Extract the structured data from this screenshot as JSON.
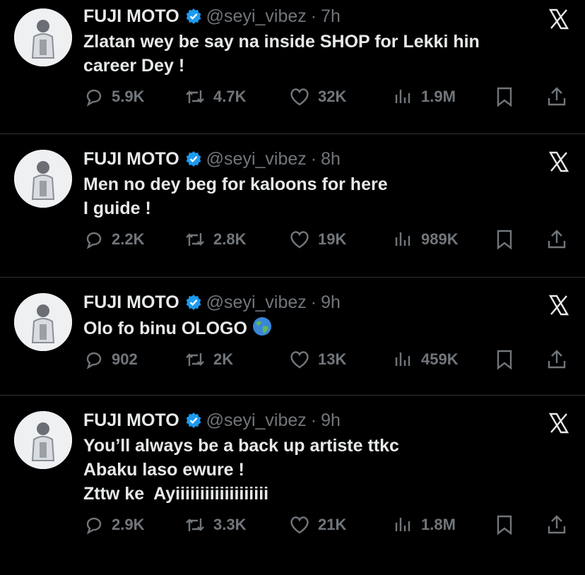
{
  "colors": {
    "background": "#000000",
    "text": "#e7e9ea",
    "muted": "#71767b",
    "verified": "#1d9bf0",
    "divider": "#2f3336"
  },
  "icons": {
    "verified": "verified-badge-icon",
    "close": "x-logo-icon",
    "reply": "reply-icon",
    "retweet": "retweet-icon",
    "like": "heart-icon",
    "views": "views-icon",
    "bookmark": "bookmark-icon",
    "share": "share-icon",
    "emoji": "globe-emoji-icon"
  },
  "tweets": [
    {
      "name": "FUJI MOTO",
      "handle": "@seyi_vibez",
      "separator": "·",
      "time": "7h",
      "lines": [
        "Zlatan wey be say na inside SHOP for Lekki hin",
        "career Dey !"
      ],
      "replies": "5.9K",
      "retweets": "4.7K",
      "likes": "32K",
      "views": "1.9M"
    },
    {
      "name": "FUJI MOTO",
      "handle": "@seyi_vibez",
      "separator": "·",
      "time": "8h",
      "lines": [
        "Men no dey beg for kaloons for here",
        "I guide !"
      ],
      "replies": "2.2K",
      "retweets": "2.8K",
      "likes": "19K",
      "views": "989K"
    },
    {
      "name": "FUJI MOTO",
      "handle": "@seyi_vibez",
      "separator": "·",
      "time": "9h",
      "lines": [
        "Olo fo binu OLOGO"
      ],
      "replies": "902",
      "retweets": "2K",
      "likes": "13K",
      "views": "459K"
    },
    {
      "name": "FUJI MOTO",
      "handle": "@seyi_vibez",
      "separator": "·",
      "time": "9h",
      "lines": [
        "You’ll always be a back up artiste ttkc",
        "Abaku laso ewure !",
        "Zttw ke  Ayiiiiiiiiiiiiiiiiiii"
      ],
      "replies": "2.9K",
      "retweets": "3.3K",
      "likes": "21K",
      "views": "1.8M"
    }
  ]
}
